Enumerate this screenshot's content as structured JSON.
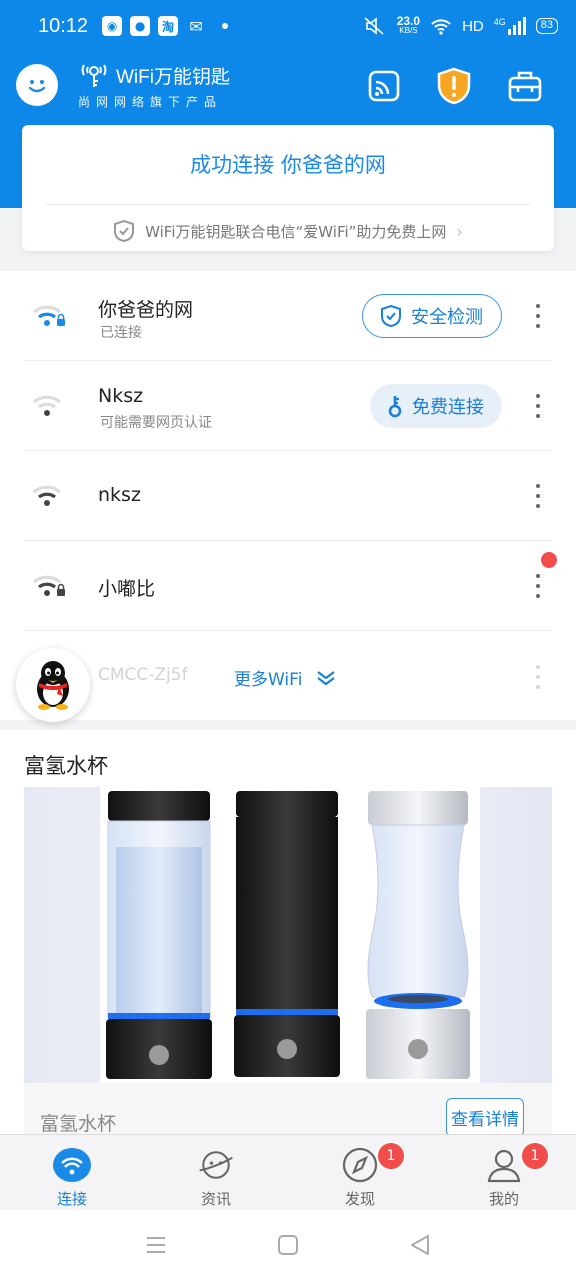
{
  "status_bar": {
    "time": "10:12",
    "net_speed_value": "23.0",
    "net_speed_unit": "KB/S",
    "hd": "HD",
    "network": "4G",
    "battery": "83"
  },
  "header": {
    "brand_title": "WiFi万能钥匙",
    "brand_subtitle": "尚网网络旗下产品",
    "accent_color": "#0e88e8"
  },
  "connection": {
    "title": "成功连接 你爸爸的网",
    "note": "WiFi万能钥匙联合电信“爱WiFi”助力免费上网"
  },
  "wifi_list": [
    {
      "name": "你爸爸的网",
      "status": "已连接",
      "action": "安全检测",
      "locked": true
    },
    {
      "name": "Nksz",
      "status": "可能需要网页认证",
      "action": "免费连接",
      "locked": false
    },
    {
      "name": "nksz",
      "status": "",
      "action": "",
      "locked": false
    },
    {
      "name": "小嘟比",
      "status": "",
      "action": "",
      "locked": true
    }
  ],
  "more": {
    "ghost_name": "CMCC-Zj5f",
    "label": "更多WiFi"
  },
  "ad": {
    "section_title": "富氢水杯",
    "product_name": "富氢水杯",
    "cta": "查看详情"
  },
  "tabs": [
    {
      "label": "连接",
      "icon": "wifi-tab-icon",
      "active": true,
      "badge": ""
    },
    {
      "label": "资讯",
      "icon": "planet-icon",
      "active": false,
      "badge": ""
    },
    {
      "label": "发现",
      "icon": "compass-icon",
      "active": false,
      "badge": "1"
    },
    {
      "label": "我的",
      "icon": "user-icon",
      "active": false,
      "badge": "1"
    }
  ]
}
